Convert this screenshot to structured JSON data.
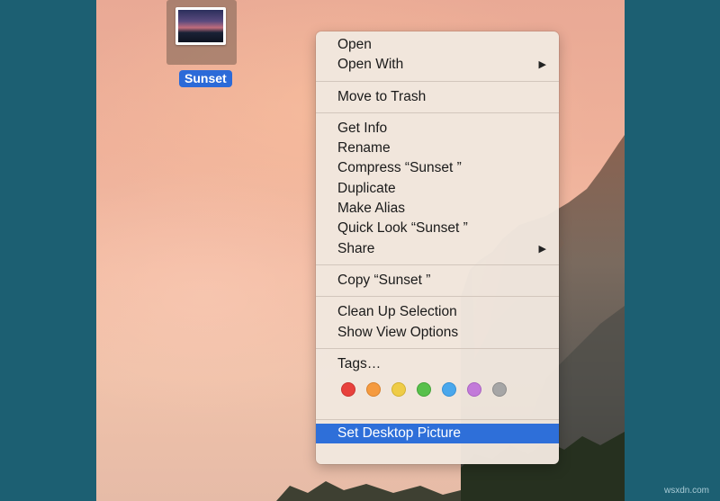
{
  "file": {
    "label": "Sunset"
  },
  "menu": {
    "groups": [
      [
        {
          "label": "Open"
        },
        {
          "label": "Open With",
          "submenu": true
        }
      ],
      [
        {
          "label": "Move to Trash"
        }
      ],
      [
        {
          "label": "Get Info"
        },
        {
          "label": "Rename"
        },
        {
          "label": "Compress “Sunset ”"
        },
        {
          "label": "Duplicate"
        },
        {
          "label": "Make Alias"
        },
        {
          "label": "Quick Look “Sunset ”"
        },
        {
          "label": "Share",
          "submenu": true
        }
      ],
      [
        {
          "label": "Copy “Sunset ”"
        }
      ],
      [
        {
          "label": "Clean Up Selection"
        },
        {
          "label": "Show View Options"
        }
      ],
      [
        {
          "label": "Tags…"
        }
      ]
    ],
    "tag_colors": [
      "#e8413c",
      "#f59a3f",
      "#efcc47",
      "#58c04b",
      "#4aa7ec",
      "#c27ad9",
      "#a6a6a6"
    ],
    "tag_borders": [
      "#c93430",
      "#d9822e",
      "#d3b232",
      "#45a43a",
      "#3890d4",
      "#a964c2",
      "#8c8c8c"
    ],
    "selected": {
      "label": "Set Desktop Picture"
    }
  },
  "watermark": "wsxdn.com"
}
